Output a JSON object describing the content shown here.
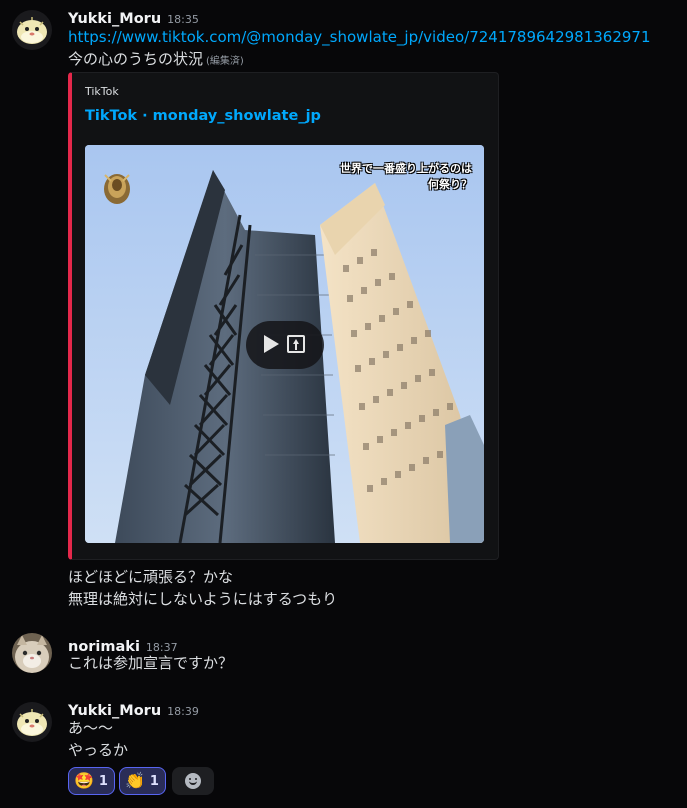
{
  "messages": [
    {
      "author": "Yukki_Moru",
      "time": "18:35",
      "link": "https://www.tiktok.com/@monday_showlate_jp/video/7241789642981362971",
      "text": "今の心のうちの状況",
      "edited": "(編集済)",
      "embed": {
        "provider": "TikTok",
        "title": "TikTok · monday_showlate_jp",
        "caption_line1": "世界で一番盛り上がるのは",
        "caption_line2": "何祭り？"
      },
      "followups": [
        "ほどほどに頑張る？かな",
        "無理は絶対にしないようにはするつもり"
      ]
    },
    {
      "author": "norimaki",
      "time": "18:37",
      "text": "これは参加宣言ですか？"
    },
    {
      "author": "Yukki_Moru",
      "time": "18:39",
      "lines": [
        "あ〜〜",
        "やっるか"
      ],
      "reactions": [
        {
          "emoji": "🤩",
          "count": "1"
        },
        {
          "emoji": "👏",
          "count": "1"
        }
      ]
    }
  ],
  "colors": {
    "background": "#070709",
    "link": "#00a8fc",
    "embed_accent": "#e4284b",
    "reaction_border": "#5865f2"
  },
  "icons": {
    "play": "play-icon",
    "external": "external-link-icon",
    "add_reaction": "add-reaction-icon"
  }
}
